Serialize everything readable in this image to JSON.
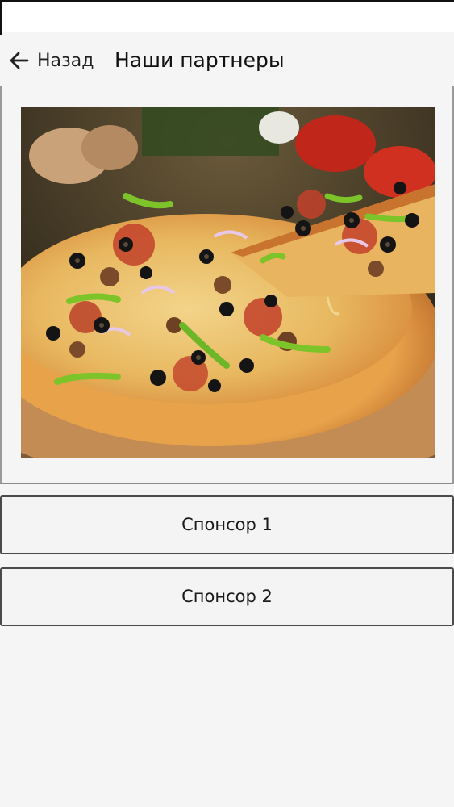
{
  "header": {
    "back_label": "Назад",
    "title": "Наши партнеры"
  },
  "banner": {
    "icon": "pizza-image"
  },
  "sponsors": [
    {
      "label": "Спонсор 1"
    },
    {
      "label": "Спонсор 2"
    }
  ],
  "colors": {
    "background": "#f5f5f5",
    "border": "#4a4a4a"
  }
}
